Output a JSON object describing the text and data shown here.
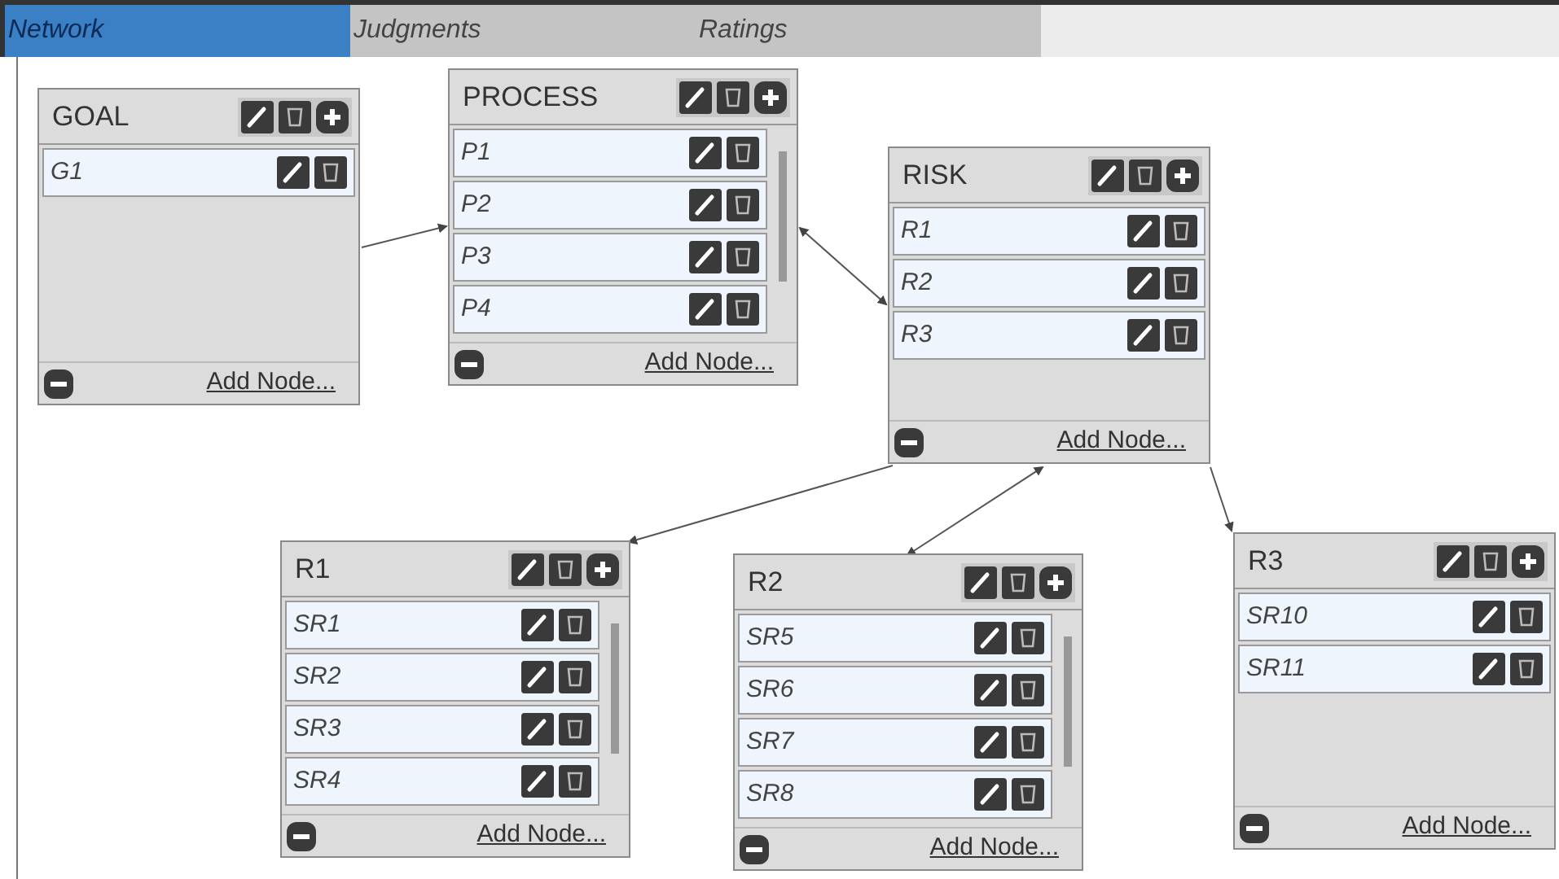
{
  "tabs": [
    {
      "label": "Network",
      "selected": true
    },
    {
      "label": "Judgments",
      "selected": false
    },
    {
      "label": "Ratings",
      "selected": false
    }
  ],
  "clusters": [
    {
      "name": "GOAL",
      "nodes": [
        "G1"
      ],
      "add_label": "Add Node..."
    },
    {
      "name": "PROCESS",
      "nodes": [
        "P1",
        "P2",
        "P3",
        "P4"
      ],
      "add_label": "Add Node..."
    },
    {
      "name": "RISK",
      "nodes": [
        "R1",
        "R2",
        "R3"
      ],
      "add_label": "Add Node..."
    },
    {
      "name": "R1",
      "nodes": [
        "SR1",
        "SR2",
        "SR3",
        "SR4"
      ],
      "add_label": "Add Node..."
    },
    {
      "name": "R2",
      "nodes": [
        "SR5",
        "SR6",
        "SR7",
        "SR8"
      ],
      "add_label": "Add Node..."
    },
    {
      "name": "R3",
      "nodes": [
        "SR10",
        "SR11"
      ],
      "add_label": "Add Node..."
    }
  ]
}
